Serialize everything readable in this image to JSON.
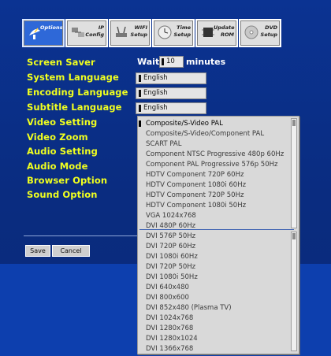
{
  "toolbar": {
    "buttons": [
      {
        "line1": "",
        "line2": "Options",
        "icon": "satellite-dish-icon",
        "active": true
      },
      {
        "line1": "IP",
        "line2": "Config",
        "icon": "network-icon",
        "active": false
      },
      {
        "line1": "WIFI",
        "line2": "Setup",
        "icon": "wifi-router-icon",
        "active": false
      },
      {
        "line1": "Time",
        "line2": "Setup",
        "icon": "clock-icon",
        "active": false
      },
      {
        "line1": "Update",
        "line2": "ROM",
        "icon": "chip-icon",
        "active": false
      },
      {
        "line1": "DVD",
        "line2": "Setup",
        "icon": "disc-icon",
        "active": false
      }
    ]
  },
  "settings": {
    "screen_saver": "Screen Saver",
    "system_language": "System Language",
    "encoding_language": "Encoding Language",
    "subtitle_language": "Subtitle Language",
    "video_setting": "Video Setting",
    "video_zoom": "Video Zoom",
    "audio_setting": "Audio Setting",
    "audio_mode": "Audio Mode",
    "browser_option": "Browser Option",
    "sound_option": "Sound Option"
  },
  "screen_saver": {
    "prefix": "Wait",
    "value": "10",
    "suffix": "minutes"
  },
  "languages": {
    "system": "English",
    "encoding": "English",
    "subtitle": "English"
  },
  "bottom_buttons": {
    "save": "Save",
    "cancel": "Cancel"
  },
  "video_options": [
    "Composite/S-Video PAL",
    "Composite/S-Video/Component PAL",
    "SCART PAL",
    "Component NTSC Progressive 480p 60Hz",
    "Component PAL Progressive 576p 50Hz",
    "HDTV Component 720P 60Hz",
    "HDTV Component 1080i 60Hz",
    "HDTV Component 720P 50Hz",
    "HDTV Component 1080i 50Hz",
    "VGA 1024x768",
    "DVI 480P 60Hz",
    "DVI 576P 50Hz",
    "DVI 720P 60Hz",
    "DVI 1080i 60Hz",
    "DVI 720P 50Hz",
    "DVI 1080i 50Hz",
    "DVI 640x480",
    "DVI 800x600",
    "DVI 852x480 (Plasma TV)",
    "DVI 1024x768",
    "DVI 1280x768",
    "DVI 1280x1024",
    "DVI 1366x768"
  ],
  "colors": {
    "background": "#0a2f82",
    "label_yellow": "#f0ff1f",
    "active_tab": "#2e68d8"
  }
}
